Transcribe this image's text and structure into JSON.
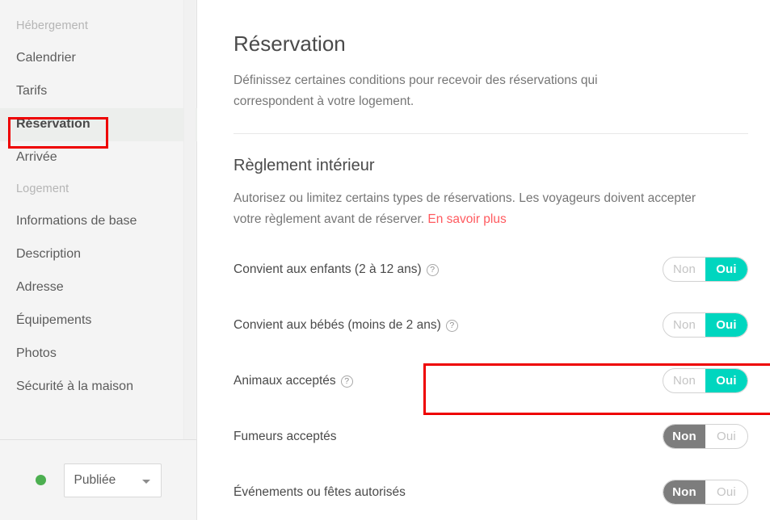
{
  "sidebar": {
    "groups": [
      {
        "label": "Hébergement",
        "items": [
          {
            "label": "Calendrier",
            "selected": false
          },
          {
            "label": "Tarifs",
            "selected": false
          },
          {
            "label": "Réservation",
            "selected": true
          },
          {
            "label": "Arrivée",
            "selected": false
          }
        ]
      },
      {
        "label": "Logement",
        "items": [
          {
            "label": "Informations de base",
            "selected": false
          },
          {
            "label": "Description",
            "selected": false
          },
          {
            "label": "Adresse",
            "selected": false
          },
          {
            "label": "Équipements",
            "selected": false
          },
          {
            "label": "Photos",
            "selected": false
          },
          {
            "label": "Sécurité à la maison",
            "selected": false
          }
        ]
      }
    ],
    "footer": {
      "status_label": "Publiée",
      "status_color": "#4caf50",
      "caret_icon": "chevron-down-icon"
    },
    "scrollbar": {
      "up_icon": "scroll-up-arrow-icon",
      "down_icon": "scroll-down-arrow-icon"
    }
  },
  "main": {
    "title": "Réservation",
    "subtitle": "Définissez certaines conditions pour recevoir des réservations qui correspondent à votre logement.",
    "section": {
      "title": "Règlement intérieur",
      "description": "Autorisez ou limitez certains types de réservations. Les voyageurs doivent accepter votre règlement avant de réserver. ",
      "link_text": "En savoir plus"
    },
    "toggle_options": {
      "no": "Non",
      "yes": "Oui"
    },
    "rules": [
      {
        "label": "Convient aux enfants (2 à 12 ans)",
        "has_help": true,
        "value": "Oui",
        "highlighted": false
      },
      {
        "label": "Convient aux bébés (moins de 2 ans)",
        "has_help": true,
        "value": "Oui",
        "highlighted": false
      },
      {
        "label": "Animaux acceptés",
        "has_help": true,
        "value": "Oui",
        "highlighted": true
      },
      {
        "label": "Fumeurs acceptés",
        "has_help": false,
        "value": "Non",
        "highlighted": false
      },
      {
        "label": "Événements ou fêtes autorisés",
        "has_help": false,
        "value": "Non",
        "highlighted": false
      }
    ]
  },
  "annotations": {
    "accent_color": "#ee0000",
    "sidebar_box_target": "Réservation",
    "row_box_target": "Animaux acceptés"
  }
}
